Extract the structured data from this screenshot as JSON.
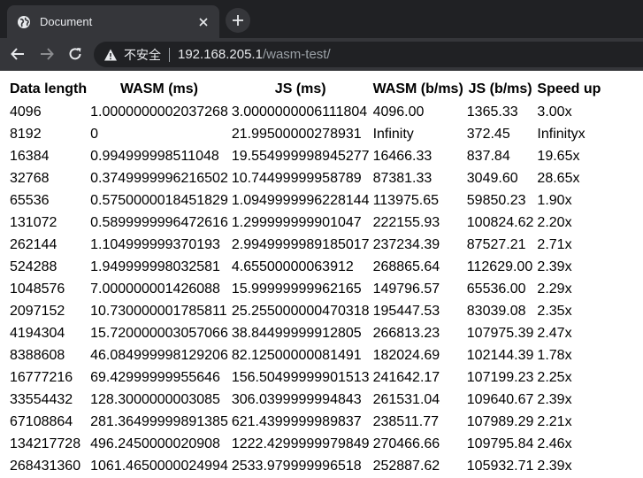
{
  "browser": {
    "tab_title": "Document",
    "security_label": "不安全",
    "url_host": "192.168.205.1",
    "url_path": "/wasm-test/"
  },
  "table": {
    "headers": [
      "Data length",
      "WASM (ms)",
      "JS (ms)",
      "WASM (b/ms)",
      "JS (b/ms)",
      "Speed up"
    ],
    "rows": [
      [
        "4096",
        "1.0000000002037268",
        "3.0000000006111804",
        "4096.00",
        "1365.33",
        "3.00x"
      ],
      [
        "8192",
        "0",
        "21.99500000278931",
        "Infinity",
        "372.45",
        "Infinityx"
      ],
      [
        "16384",
        "0.994999998511048",
        "19.554999998945277",
        "16466.33",
        "837.84",
        "19.65x"
      ],
      [
        "32768",
        "0.3749999996216502",
        "10.74499999958789",
        "87381.33",
        "3049.60",
        "28.65x"
      ],
      [
        "65536",
        "0.5750000018451829",
        "1.0949999996228144",
        "113975.65",
        "59850.23",
        "1.90x"
      ],
      [
        "131072",
        "0.5899999996472616",
        "1.299999999901047",
        "222155.93",
        "100824.62",
        "2.20x"
      ],
      [
        "262144",
        "1.104999999370193",
        "2.9949999989185017",
        "237234.39",
        "87527.21",
        "2.71x"
      ],
      [
        "524288",
        "1.949999998032581",
        "4.65500000063912",
        "268865.64",
        "112629.00",
        "2.39x"
      ],
      [
        "1048576",
        "7.000000001426088",
        "15.99999999962165",
        "149796.57",
        "65536.00",
        "2.29x"
      ],
      [
        "2097152",
        "10.730000001785811",
        "25.255000000470318",
        "195447.53",
        "83039.08",
        "2.35x"
      ],
      [
        "4194304",
        "15.720000003057066",
        "38.84499999912805",
        "266813.23",
        "107975.39",
        "2.47x"
      ],
      [
        "8388608",
        "46.084999998129206",
        "82.12500000081491",
        "182024.69",
        "102144.39",
        "1.78x"
      ],
      [
        "16777216",
        "69.42999999955646",
        "156.50499999901513",
        "241642.17",
        "107199.23",
        "2.25x"
      ],
      [
        "33554432",
        "128.3000000003085",
        "306.0399999994843",
        "261531.04",
        "109640.67",
        "2.39x"
      ],
      [
        "67108864",
        "281.36499999891385",
        "621.4399999989837",
        "238511.77",
        "107989.29",
        "2.21x"
      ],
      [
        "134217728",
        "496.2450000020908",
        "1222.4299999979849",
        "270466.66",
        "109795.84",
        "2.46x"
      ],
      [
        "268431360",
        "1061.4650000024994",
        "2533.979999996518",
        "252887.62",
        "105932.71",
        "2.39x"
      ]
    ]
  },
  "colors": {
    "tabstrip_bg": "#202124",
    "toolbar_bg": "#35363a",
    "chrome_text": "#e8eaed",
    "url_path": "#9aa0a6"
  }
}
